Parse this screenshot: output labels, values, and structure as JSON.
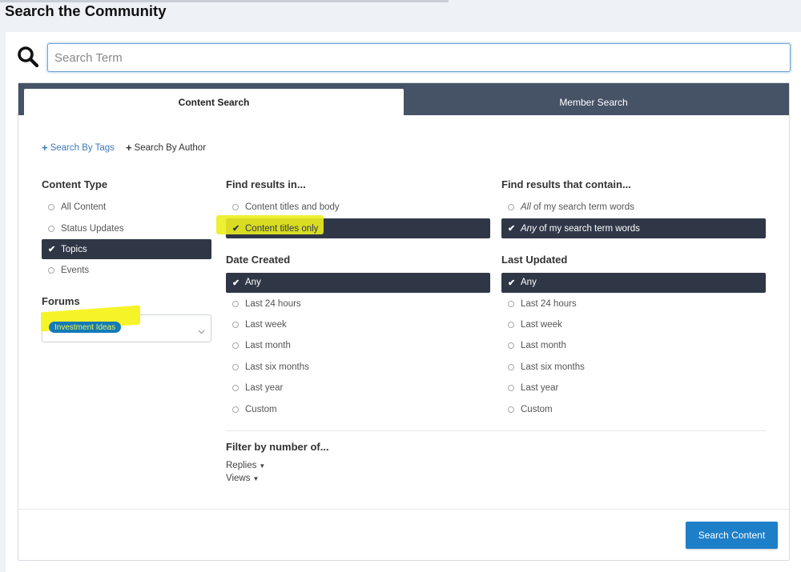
{
  "page": {
    "title": "Search the Community"
  },
  "search": {
    "placeholder": "Search Term",
    "value": ""
  },
  "tabs": [
    {
      "label": "Content Search",
      "active": true
    },
    {
      "label": "Member Search",
      "active": false
    }
  ],
  "links": {
    "tags": "Search By Tags",
    "author": "Search By Author"
  },
  "content_type": {
    "title": "Content Type",
    "options": [
      "All Content",
      "Status Updates",
      "Topics",
      "Events"
    ],
    "selected": "Topics"
  },
  "forums": {
    "title": "Forums",
    "selected_chip": "Investment Ideas"
  },
  "find_in": {
    "title": "Find results in...",
    "options": [
      "Content titles and body",
      "Content titles only"
    ],
    "selected": "Content titles only"
  },
  "contain": {
    "title": "Find results that contain...",
    "all_em": "All",
    "all_rest": " of my search term words",
    "any_em": "Any",
    "any_rest": " of my search term words",
    "selected": "Any"
  },
  "date_created": {
    "title": "Date Created",
    "options": [
      "Any",
      "Last 24 hours",
      "Last week",
      "Last month",
      "Last six months",
      "Last year",
      "Custom"
    ],
    "selected": "Any"
  },
  "last_updated": {
    "title": "Last Updated",
    "options": [
      "Any",
      "Last 24 hours",
      "Last week",
      "Last month",
      "Last six months",
      "Last year",
      "Custom"
    ],
    "selected": "Any"
  },
  "filter": {
    "title": "Filter by number of...",
    "replies": "Replies",
    "views": "Views"
  },
  "submit": {
    "label": "Search Content"
  },
  "colors": {
    "tab_bar": "#465266",
    "selected": "#2f3747",
    "button": "#1e7fc9",
    "link": "#3d7ab8"
  }
}
